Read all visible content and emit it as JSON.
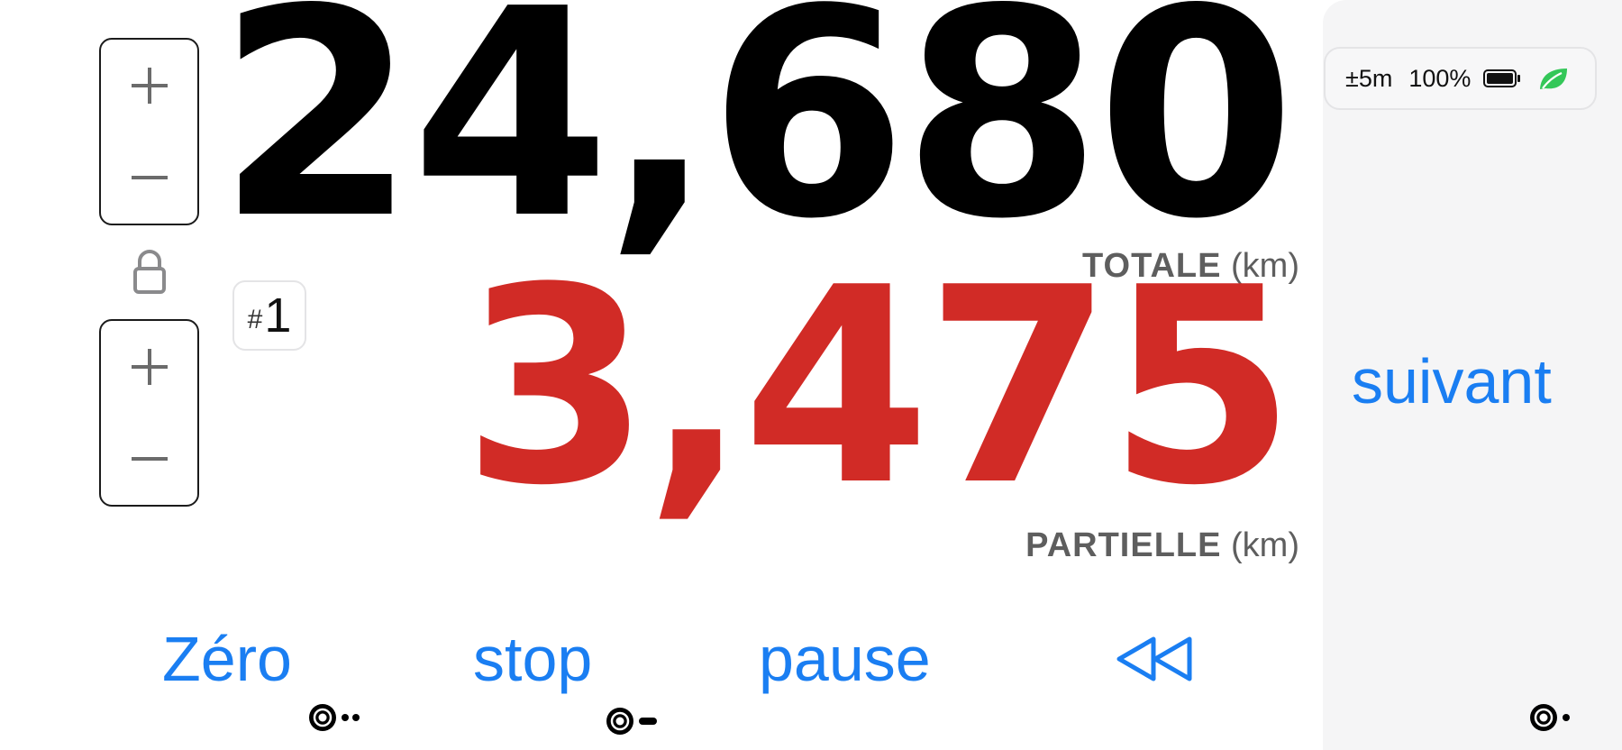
{
  "odometer": {
    "total": {
      "value": "24,680",
      "name": "TOTALE",
      "unit": "(km)"
    },
    "partial": {
      "value": "3,475",
      "name": "PARTIELLE",
      "unit": "(km)"
    },
    "trip_badge": {
      "hash": "#",
      "number": "1"
    }
  },
  "actions": {
    "zero": "Zéro",
    "stop": "stop",
    "pause": "pause",
    "rewind_icon": "rewind-icon",
    "next": "suivant"
  },
  "status": {
    "gps_accuracy": "±5m",
    "battery_percent": "100%",
    "battery_icon": "battery-icon",
    "eco_icon": "leaf-icon"
  },
  "colors": {
    "total": "#000000",
    "partial": "#d12b26",
    "accent": "#1a7ef2",
    "eco": "#34c759",
    "panel": "#f5f5f6"
  }
}
